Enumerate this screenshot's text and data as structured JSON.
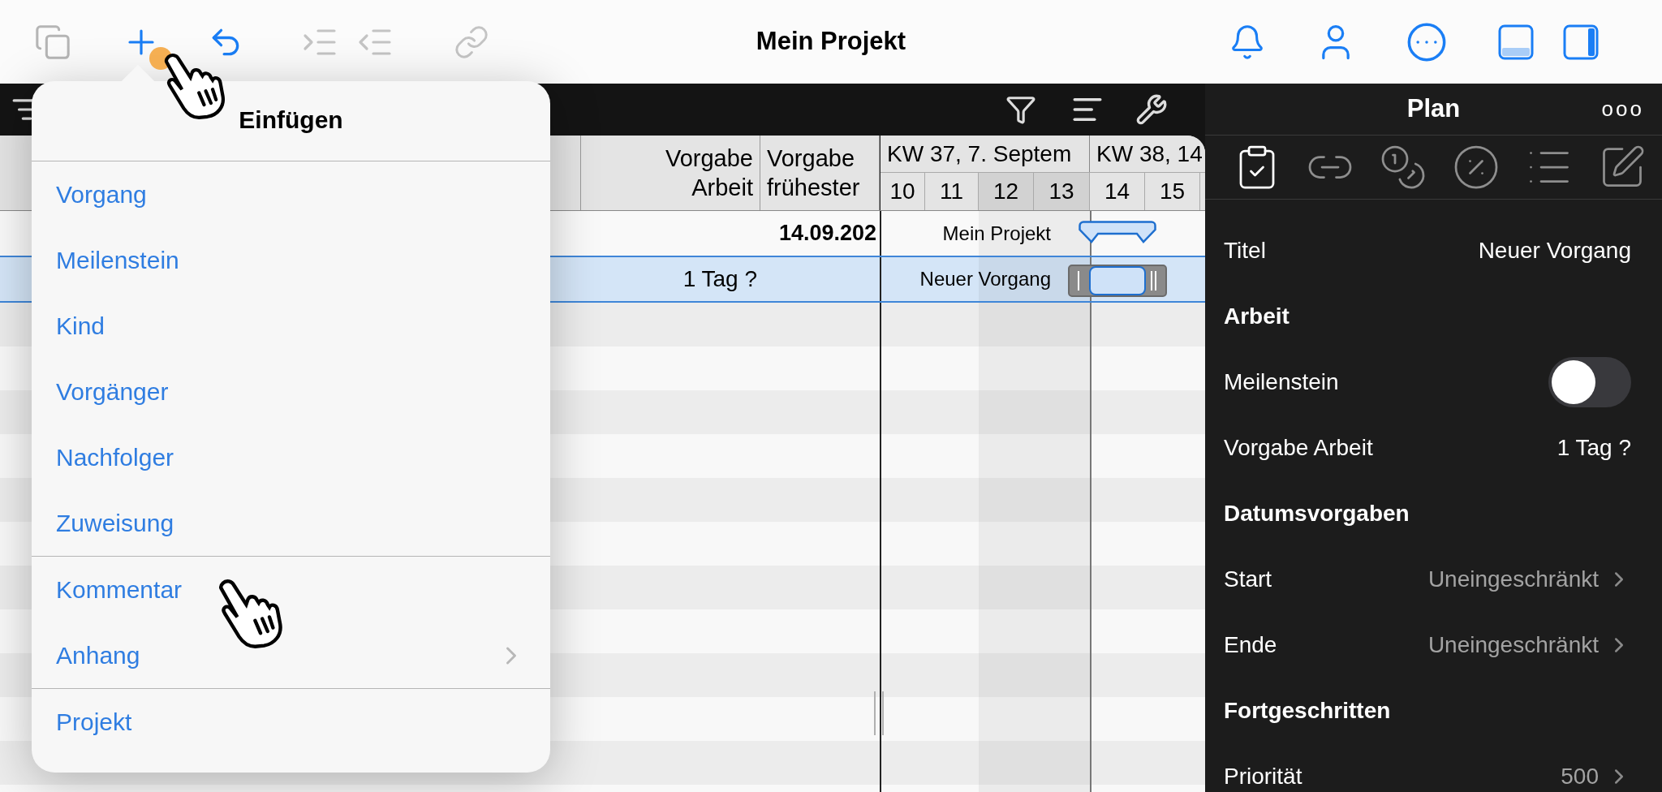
{
  "toolbar": {
    "title": "Mein Projekt"
  },
  "insert_menu": {
    "title": "Einfügen",
    "groups": [
      [
        {
          "label": "Vorgang",
          "has_submenu": false
        },
        {
          "label": "Meilenstein",
          "has_submenu": false
        },
        {
          "label": "Kind",
          "has_submenu": false
        },
        {
          "label": "Vorgänger",
          "has_submenu": false
        },
        {
          "label": "Nachfolger",
          "has_submenu": false
        },
        {
          "label": "Zuweisung",
          "has_submenu": false
        }
      ],
      [
        {
          "label": "Kommentar",
          "has_submenu": false
        },
        {
          "label": "Anhang",
          "has_submenu": true
        }
      ],
      [
        {
          "label": "Projekt",
          "has_submenu": false
        }
      ]
    ]
  },
  "table": {
    "columns": [
      {
        "lines": [
          "Vorgabe",
          "Arbeit"
        ]
      },
      {
        "lines": [
          "Vorgabe",
          "frühester"
        ]
      }
    ],
    "weeks": [
      "KW 37, 7. Septem",
      "KW 38, 14"
    ],
    "days": [
      {
        "label": "10",
        "weekend": false
      },
      {
        "label": "11",
        "weekend": false
      },
      {
        "label": "12",
        "weekend": true
      },
      {
        "label": "13",
        "weekend": true
      },
      {
        "label": "14",
        "weekend": false
      },
      {
        "label": "15",
        "weekend": false
      }
    ],
    "rows": [
      {
        "kind": "summary",
        "selected": false,
        "cells": [
          "",
          "14.09.202"
        ],
        "bar_label": "Mein Projekt"
      },
      {
        "kind": "task",
        "selected": true,
        "cells": [
          "1 Tag ?",
          ""
        ],
        "bar_label": "Neuer Vorgang"
      }
    ]
  },
  "inspector": {
    "title": "Plan",
    "menu": "ooo",
    "tabs": [
      {
        "selected": true
      },
      {
        "selected": false
      },
      {
        "selected": false
      },
      {
        "selected": false
      },
      {
        "selected": false
      },
      {
        "selected": false
      }
    ],
    "rows": [
      {
        "kind": "field",
        "label": "Titel",
        "value": "Neuer Vorgang"
      },
      {
        "kind": "section",
        "label": "Arbeit"
      },
      {
        "kind": "toggle",
        "label": "Meilenstein",
        "on": false
      },
      {
        "kind": "field",
        "label": "Vorgabe Arbeit",
        "value": "1 Tag ?"
      },
      {
        "kind": "section",
        "label": "Datumsvorgaben"
      },
      {
        "kind": "link",
        "label": "Start",
        "value": "Uneingeschränkt"
      },
      {
        "kind": "link",
        "label": "Ende",
        "value": "Uneingeschränkt"
      },
      {
        "kind": "section",
        "label": "Fortgeschritten"
      },
      {
        "kind": "link",
        "label": "Priorität",
        "value": "500"
      }
    ]
  }
}
